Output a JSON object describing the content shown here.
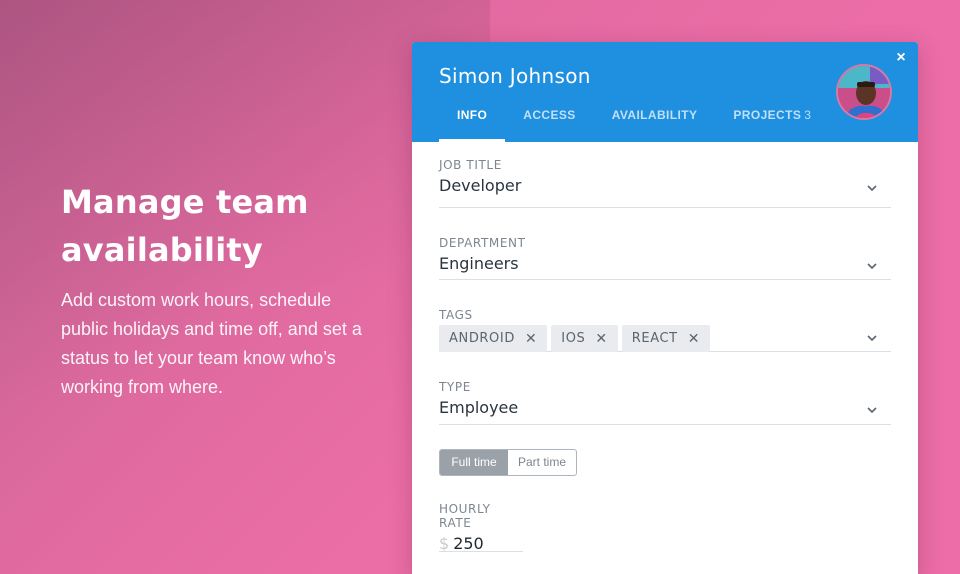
{
  "promo": {
    "heading": "Manage team availability",
    "body": "Add custom work hours, schedule public holidays and time off, and set a status to let your team know who’s working from where."
  },
  "profile": {
    "name": "Simon Johnson",
    "close_label": "×",
    "avatar_icon": "avatar-photo",
    "tabs": [
      {
        "label": "INFO",
        "active": true
      },
      {
        "label": "ACCESS"
      },
      {
        "label": "AVAILABILITY"
      },
      {
        "label": "PROJECTS",
        "count": "3"
      }
    ]
  },
  "form": {
    "job_title": {
      "label": "JOB TITLE",
      "value": "Developer"
    },
    "department": {
      "label": "DEPARTMENT",
      "value": "Engineers"
    },
    "tags": {
      "label": "TAGS",
      "items": [
        {
          "label": "ANDROID",
          "remove": "✕"
        },
        {
          "label": "IOS",
          "remove": "✕"
        },
        {
          "label": "REACT",
          "remove": "✕"
        }
      ]
    },
    "type": {
      "label": "TYPE",
      "value": "Employee"
    },
    "employment": {
      "options": [
        "Full time",
        "Part time"
      ],
      "selected": "Full time"
    },
    "hourly_rate": {
      "label": "HOURLY RATE",
      "currency": "$",
      "value": "250"
    }
  },
  "colors": {
    "header_blue": "#1f8fe0",
    "background_pink": "#ec6ea7"
  }
}
